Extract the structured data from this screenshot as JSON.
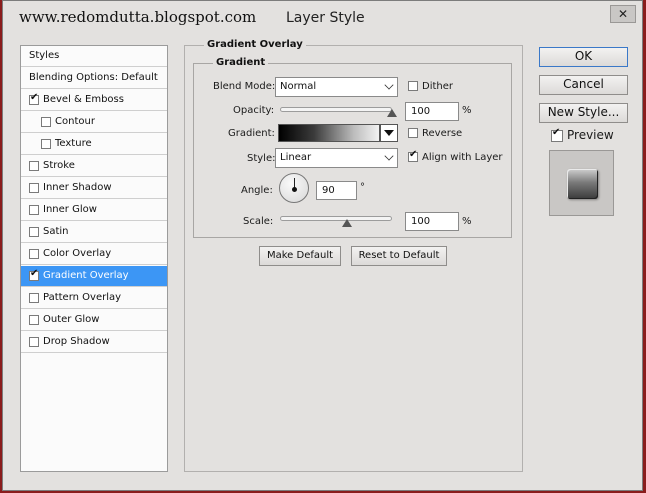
{
  "watermark": "www.redomdutta.blogspot.com",
  "window_title": "Layer Style",
  "close_glyph": "✕",
  "styles_list": {
    "header": "Styles",
    "blending_options": "Blending Options: Default",
    "items": [
      {
        "label": "Bevel & Emboss",
        "checked": true,
        "selected": false,
        "indent": 0
      },
      {
        "label": "Contour",
        "checked": false,
        "selected": false,
        "indent": 1
      },
      {
        "label": "Texture",
        "checked": false,
        "selected": false,
        "indent": 1
      },
      {
        "label": "Stroke",
        "checked": false,
        "selected": false,
        "indent": 0
      },
      {
        "label": "Inner Shadow",
        "checked": false,
        "selected": false,
        "indent": 0
      },
      {
        "label": "Inner Glow",
        "checked": false,
        "selected": false,
        "indent": 0
      },
      {
        "label": "Satin",
        "checked": false,
        "selected": false,
        "indent": 0
      },
      {
        "label": "Color Overlay",
        "checked": false,
        "selected": false,
        "indent": 0
      },
      {
        "label": "Gradient Overlay",
        "checked": true,
        "selected": true,
        "indent": 0
      },
      {
        "label": "Pattern Overlay",
        "checked": false,
        "selected": false,
        "indent": 0
      },
      {
        "label": "Outer Glow",
        "checked": false,
        "selected": false,
        "indent": 0
      },
      {
        "label": "Drop Shadow",
        "checked": false,
        "selected": false,
        "indent": 0
      }
    ]
  },
  "gradient_overlay": {
    "group_title": "Gradient Overlay",
    "subgroup_title": "Gradient",
    "blend_mode_label": "Blend Mode:",
    "blend_mode_value": "Normal",
    "dither_label": "Dither",
    "dither_checked": false,
    "opacity_label": "Opacity:",
    "opacity_value": "100",
    "opacity_unit": "%",
    "opacity_fraction": 1.0,
    "gradient_label": "Gradient:",
    "reverse_label": "Reverse",
    "reverse_checked": false,
    "style_label": "Style:",
    "style_value": "Linear",
    "align_label": "Align with Layer",
    "align_checked": true,
    "angle_label": "Angle:",
    "angle_value": "90",
    "angle_unit": "°",
    "scale_label": "Scale:",
    "scale_value": "100",
    "scale_unit": "%",
    "scale_fraction": 0.6,
    "make_default": "Make Default",
    "reset_default": "Reset to Default"
  },
  "buttons": {
    "ok": "OK",
    "cancel": "Cancel",
    "new_style": "New Style...",
    "preview_label": "Preview",
    "preview_checked": true
  },
  "colors": {
    "selection": "#3c96f5",
    "dialog_bg": "#e3e1df"
  },
  "icons": {
    "check": "✔",
    "close": "close-icon",
    "dropdown": "chevron-down-icon",
    "angle": "angle-dial-icon"
  }
}
